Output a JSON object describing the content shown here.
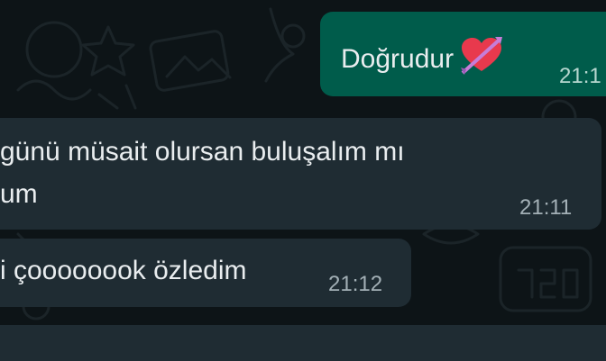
{
  "chat": {
    "messages": [
      {
        "direction": "outgoing",
        "text": "Doğrudur",
        "emoji": "heart-with-arrow",
        "time": "21:1"
      },
      {
        "direction": "incoming",
        "line1": "günü müsait olursan buluşalım mı",
        "line2": "um",
        "time": "21:11"
      },
      {
        "direction": "incoming",
        "text": "i çoooooook özledim",
        "time": "21:12"
      }
    ]
  },
  "colors": {
    "background": "#0d1417",
    "outgoing_bubble": "#005c4b",
    "incoming_bubble": "#1f2c33",
    "text": "#e9edef",
    "timestamp": "#a3b0b6"
  }
}
